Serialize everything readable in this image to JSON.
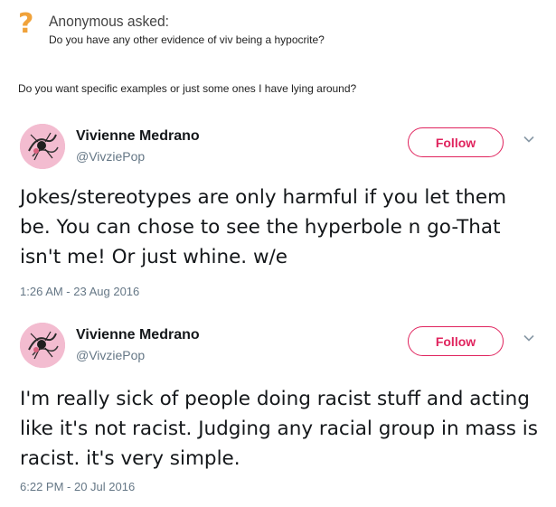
{
  "ask": {
    "icon": "question-mark-icon",
    "title": "Anonymous asked:",
    "question": "Do you have any other evidence of viv being a hypocrite?"
  },
  "answer": "Do you want specific examples or just some ones I have lying around?",
  "tweets": [
    {
      "name": "Vivienne Medrano",
      "handle": "@VivziePop",
      "follow_label": "Follow",
      "text": "Jokes/stereotypes are only harmful if you let them be. You can chose to see the hyperbole n go-That isn't me! Or just whine. w/e",
      "time": "1:26 AM - 23 Aug 2016"
    },
    {
      "name": "Vivienne Medrano",
      "handle": "@VivziePop",
      "follow_label": "Follow",
      "text": "I'm really sick of people doing racist stuff and acting like it's not racist. Judging any racial group in mass is racist. it's very simple.",
      "time": "6:22 PM - 20 Jul 2016"
    }
  ],
  "colors": {
    "accent": "#e0245e",
    "ask_icon": "#f0a23a",
    "muted": "#657786"
  }
}
